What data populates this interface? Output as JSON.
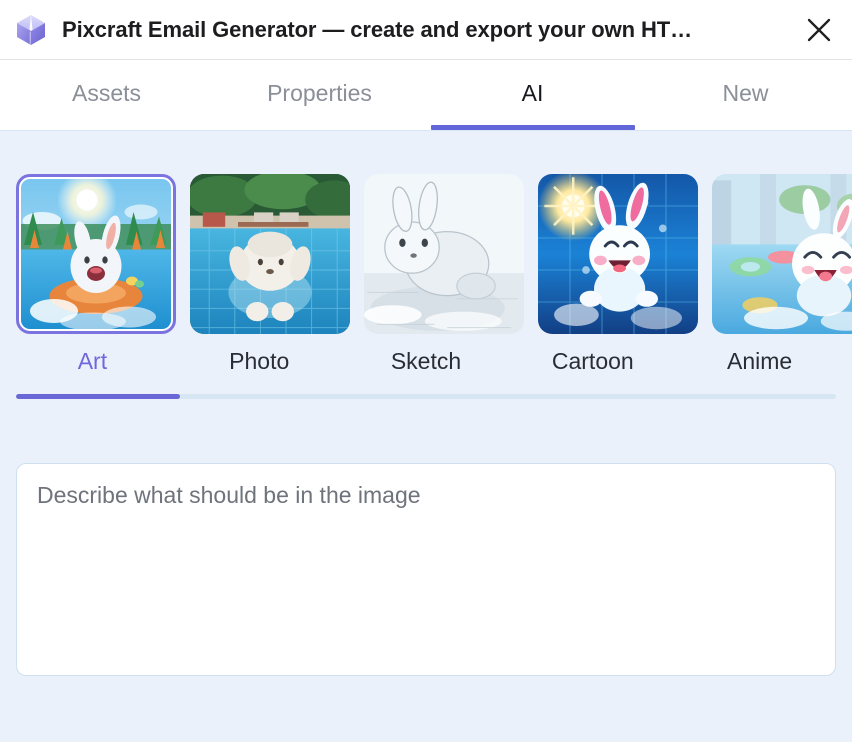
{
  "window": {
    "title": "Pixcraft Email Generator — create and export your own HT…",
    "logo_icon": "cube-logo-icon",
    "close_icon": "close-icon"
  },
  "tabs": [
    {
      "label": "Assets",
      "name": "tab-assets",
      "active": false
    },
    {
      "label": "Properties",
      "name": "tab-properties",
      "active": false
    },
    {
      "label": "AI",
      "name": "tab-ai",
      "active": true
    },
    {
      "label": "New",
      "name": "tab-new",
      "active": false
    }
  ],
  "styles": {
    "selected": "Art",
    "items": [
      {
        "label": "Art",
        "name": "style-art",
        "selected": true,
        "thumb": "bunny-pool-art"
      },
      {
        "label": "Photo",
        "name": "style-photo",
        "selected": false,
        "thumb": "bunny-pool-photo"
      },
      {
        "label": "Sketch",
        "name": "style-sketch",
        "selected": false,
        "thumb": "bunny-pool-sketch"
      },
      {
        "label": "Cartoon",
        "name": "style-cartoon",
        "selected": false,
        "thumb": "bunny-pool-cartoon"
      },
      {
        "label": "Anime",
        "name": "style-anime",
        "selected": false,
        "thumb": "bunny-pool-anime"
      }
    ],
    "track_fill_percent": "20%"
  },
  "prompt": {
    "placeholder": "Describe what should be in the image",
    "value": ""
  },
  "colors": {
    "accent": "#6366d8",
    "accent_text": "#6f68dd",
    "background": "#eaf1fa",
    "panel": "#ffffff",
    "muted_text": "#8a8f98",
    "track": "#d6e6f2"
  }
}
